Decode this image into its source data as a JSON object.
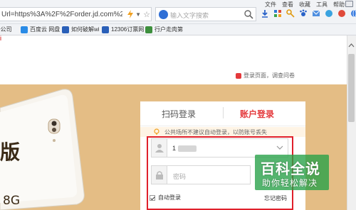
{
  "browser": {
    "url": "Url=https%3A%2F%2Forder.jd.com%2Fco",
    "search_placeholder": "输入文字搜索",
    "menu": [
      "文件",
      "查看",
      "收藏",
      "工具",
      "帮助"
    ]
  },
  "favorites": [
    {
      "label": "e公司",
      "color": "#3b7de8"
    },
    {
      "label": "百度云 网盘",
      "color": "#2a8be6"
    },
    {
      "label": "如何破解wi",
      "color": "#2a5fb8"
    },
    {
      "label": "12306订票网",
      "color": "#2a5fb8"
    },
    {
      "label": "行户走肉第",
      "color": "#3d8f3d"
    }
  ],
  "page": {
    "top_link": "i",
    "feedback": "登录页面，调查问卷"
  },
  "banner": {
    "big_char": "版",
    "spec": "8G",
    "bg_color": "#e4bd85"
  },
  "login": {
    "tab_qr": "扫码登录",
    "tab_account": "账户登录",
    "notice": "公共场所不建议自动登录，以防账号丢失",
    "username_value": "1",
    "password_placeholder": "密码",
    "auto_login": "自动登录",
    "forgot_password": "忘记密码",
    "accent": "#e4393c"
  },
  "watermark": {
    "title": "百科全说",
    "subtitle": "助你轻松解决"
  }
}
